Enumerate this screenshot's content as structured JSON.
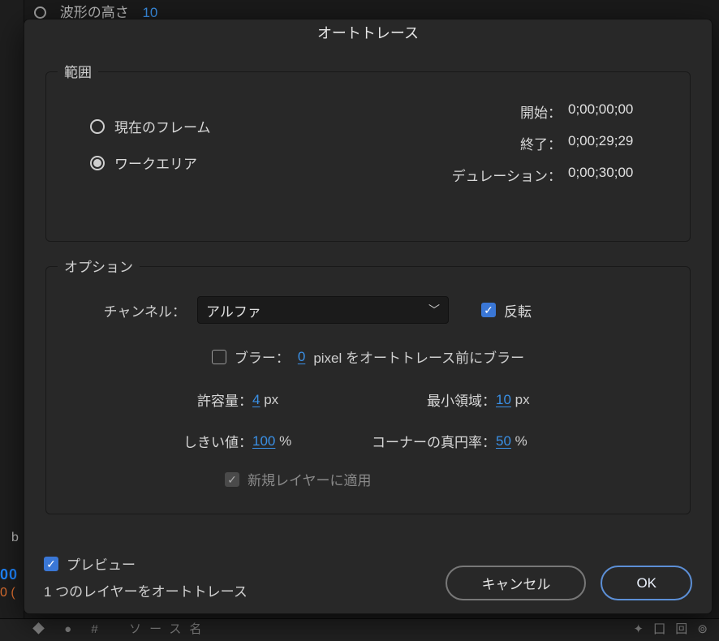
{
  "background": {
    "paramLabel": "波形の高さ",
    "paramValue": "10",
    "leftLetter": "b",
    "blueNum": "00",
    "orangeNum": "0 (",
    "bottomSource": "ソース名"
  },
  "dialog": {
    "title": "オートトレース",
    "range": {
      "legend": "範囲",
      "radio_current": "現在のフレーム",
      "radio_workarea": "ワークエリア",
      "start_label": "開始：",
      "start_value": "0;00;00;00",
      "end_label": "終了：",
      "end_value": "0;00;29;29",
      "duration_label": "デュレーション：",
      "duration_value": "0;00;30;00"
    },
    "options": {
      "legend": "オプション",
      "channel_label": "チャンネル：",
      "channel_value": "アルファ",
      "invert_label": "反転",
      "blur_prefix": "ブラー：",
      "blur_value": "0",
      "blur_suffix": "pixel をオートトレース前にブラー",
      "tolerance_label": "許容量：",
      "tolerance_value": "4",
      "tolerance_unit": "px",
      "minarea_label": "最小領域：",
      "minarea_value": "10",
      "minarea_unit": "px",
      "threshold_label": "しきい値：",
      "threshold_value": "100",
      "threshold_unit": "%",
      "roundness_label": "コーナーの真円率：",
      "roundness_value": "50",
      "roundness_unit": "%",
      "apply_new_layer": "新規レイヤーに適用"
    },
    "footer": {
      "preview_label": "プレビュー",
      "status": "1 つのレイヤーをオートトレース",
      "cancel": "キャンセル",
      "ok": "OK"
    }
  }
}
